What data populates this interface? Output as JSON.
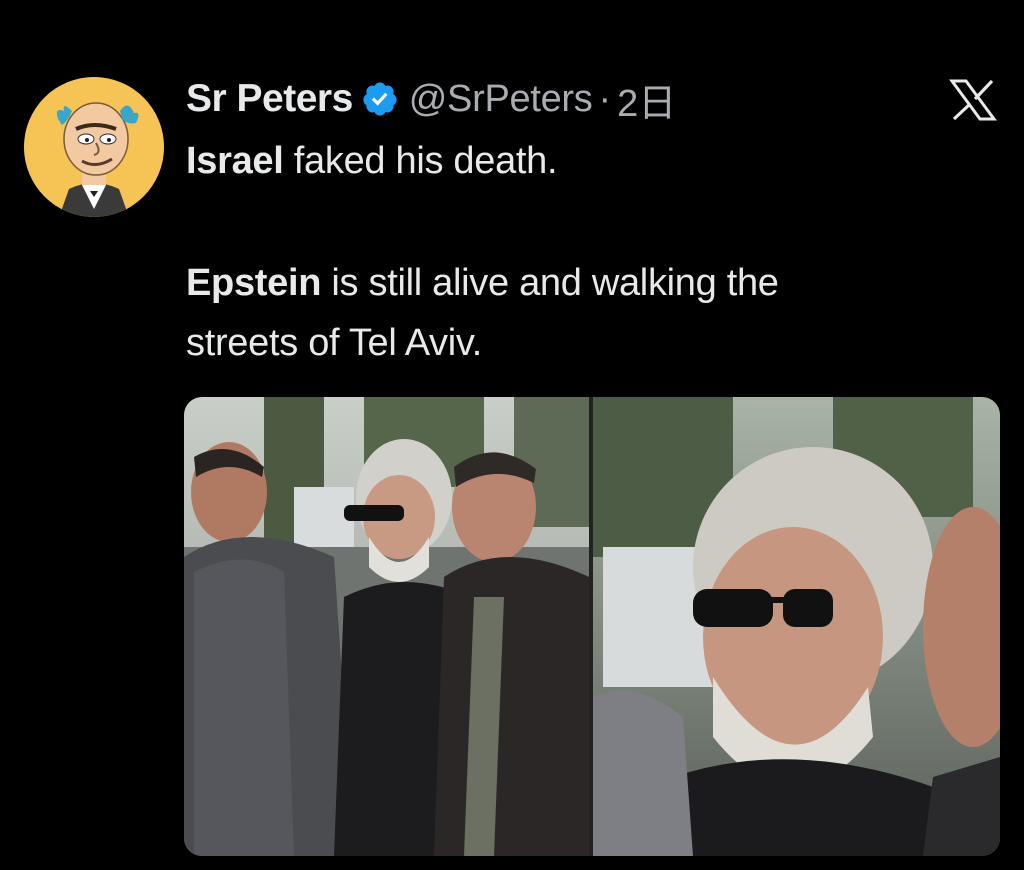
{
  "user": {
    "display_name": "Sr Peters",
    "handle": "@SrPeters",
    "separator": "·",
    "time": "2日",
    "verified": true,
    "avatar_icon": "cartoon-avatar-icon"
  },
  "tweet": {
    "line1_bold": "Israel",
    "line1_rest": " faked his death.",
    "line2_bold": "Epstein",
    "line2_rest": " is still alive and walking the",
    "line3": "streets of Tel Aviv."
  },
  "media": {
    "count": 2
  },
  "brand": {
    "logo_icon": "x-logo-icon",
    "verified_color": "#1d9bf0",
    "background": "#000000",
    "text_color": "#e7e9ea",
    "secondary_text": "#a9adb1"
  }
}
